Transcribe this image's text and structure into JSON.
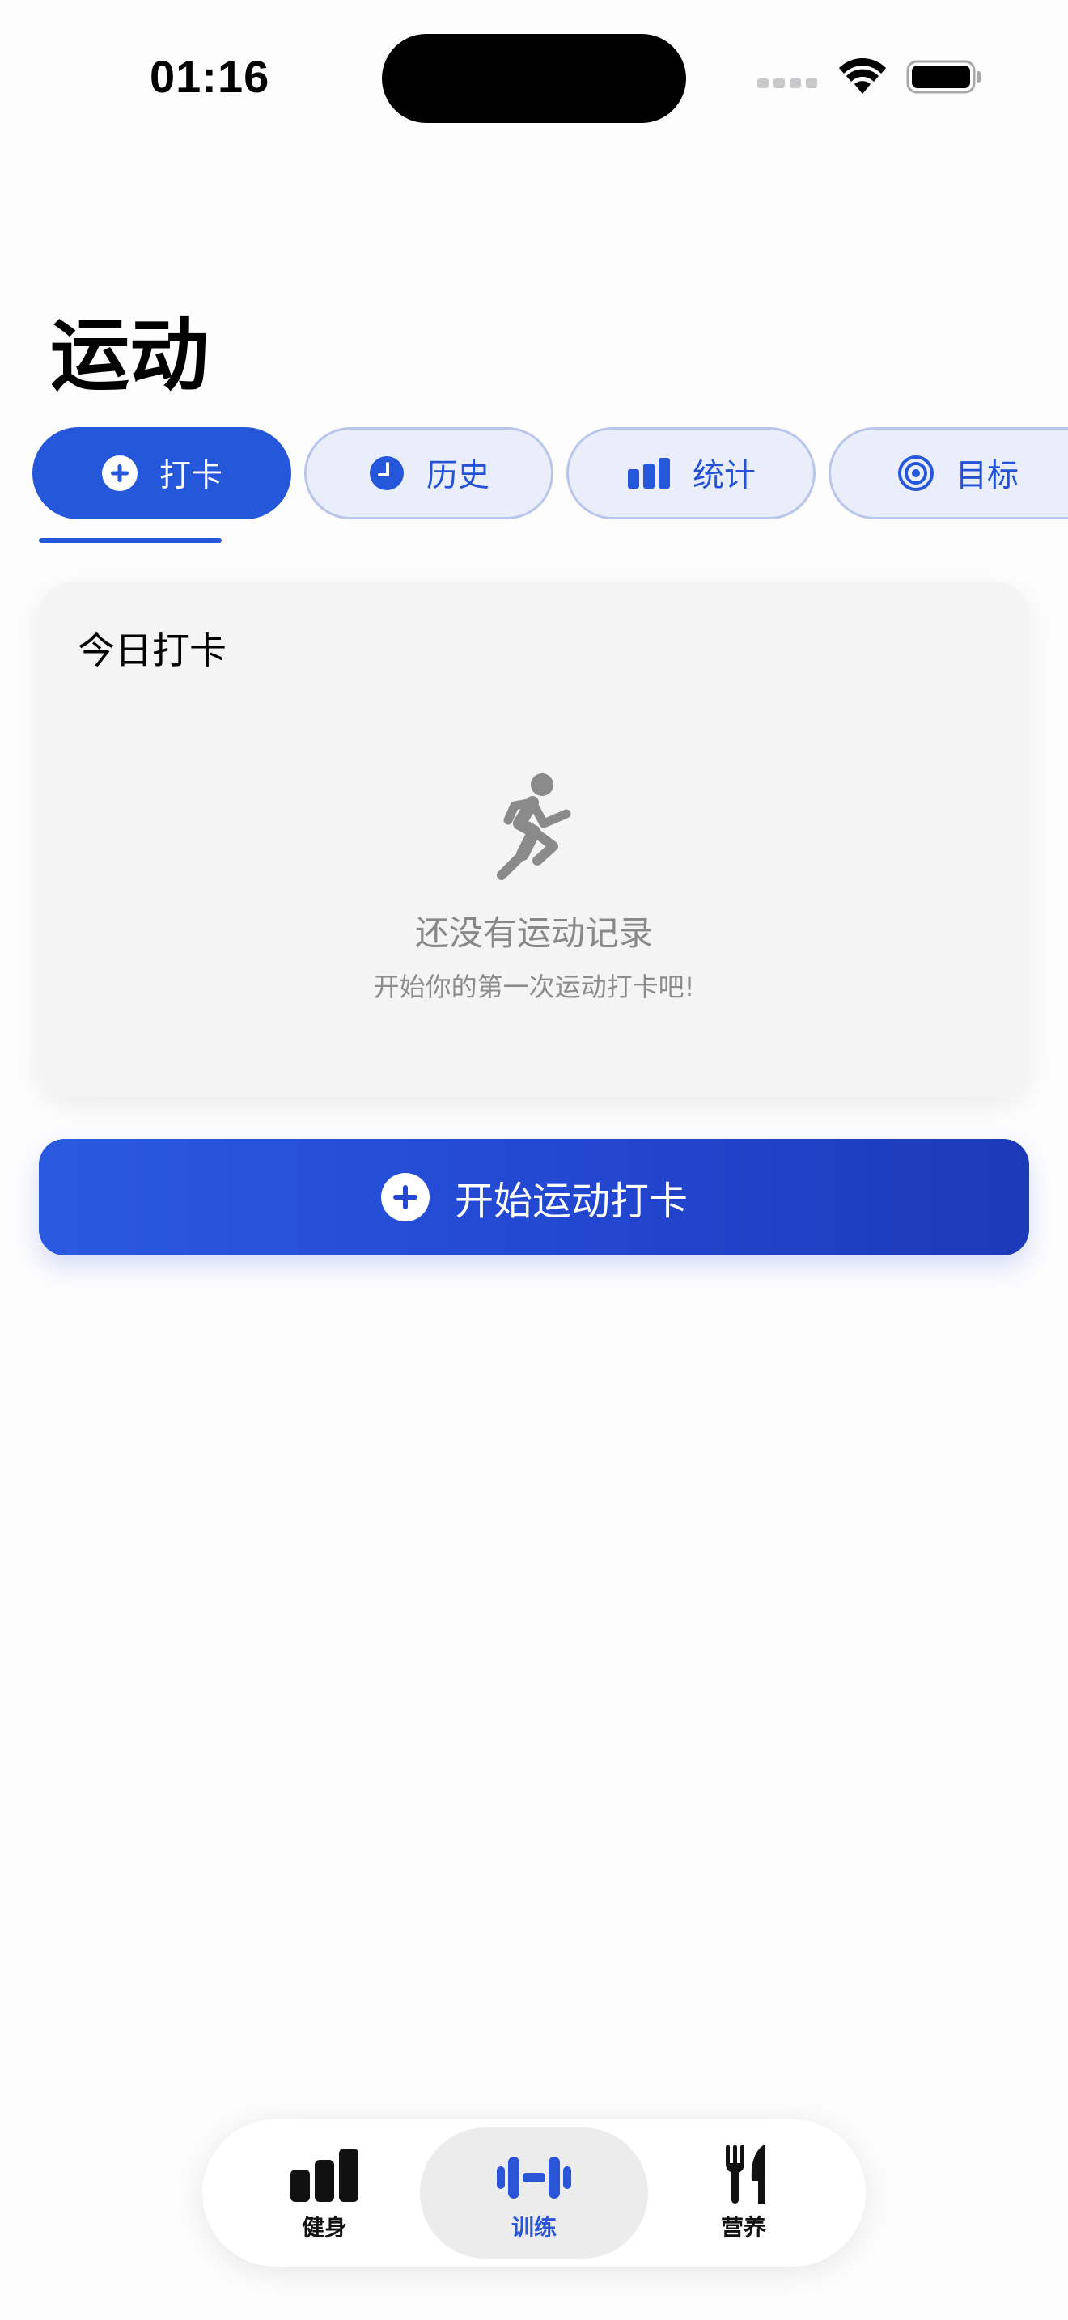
{
  "status_bar": {
    "time": "01:16"
  },
  "header": {
    "title": "运动"
  },
  "tabs": [
    {
      "label": "打卡",
      "icon": "plus-circle-icon",
      "active": true
    },
    {
      "label": "历史",
      "icon": "clock-icon",
      "active": false
    },
    {
      "label": "统计",
      "icon": "bar-chart-icon",
      "active": false
    },
    {
      "label": "目标",
      "icon": "target-icon",
      "active": false
    }
  ],
  "today_card": {
    "title": "今日打卡",
    "icon": "runner-icon",
    "empty_title": "还没有运动记录",
    "empty_subtitle": "开始你的第一次运动打卡吧!"
  },
  "start_button": {
    "label": "开始运动打卡",
    "icon": "plus-circle-icon"
  },
  "tabbar": [
    {
      "label": "健身",
      "icon": "bar-chart-icon",
      "active": false
    },
    {
      "label": "训练",
      "icon": "dumbbell-icon",
      "active": true
    },
    {
      "label": "营养",
      "icon": "fork-knife-icon",
      "active": false
    }
  ],
  "colors": {
    "accent": "#2557db",
    "tab_inactive_bg": "#e9eefa",
    "card_bg": "#f4f4f5",
    "muted_text": "#888888"
  }
}
